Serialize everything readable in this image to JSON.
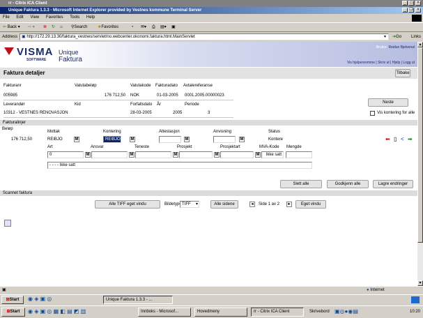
{
  "citrix": {
    "title": "rr - Citrix ICA Client"
  },
  "ie": {
    "title": "Unique Faktura 1.3.3 - Microsoft Internet Explorer provided by Vestnes kommune  Terminal Server",
    "menu": [
      "File",
      "Edit",
      "View",
      "Favorites",
      "Tools",
      "Help"
    ],
    "toolbar": {
      "back": "Back",
      "search": "Search",
      "favorites": "Favorites"
    },
    "address_label": "Address",
    "address_value": "http://172.29.13.30/faktura_vestnes/servlet/no.webcenter.okonomi.faktura.html.MainServlet",
    "go_label": "Go",
    "links_label": "Links",
    "status_zone": "Internet"
  },
  "app": {
    "brand_main": "VISMA",
    "brand_sub": "SOFTWARE",
    "product_line1": "Unique",
    "product_line2": "Faktura",
    "user_prefix": "Bruker:",
    "user_name": "Reidun Bjelvenal",
    "nav": [
      "Vis hjelpereomme",
      "Skriv ut",
      "Hjelp",
      "Logg ut"
    ],
    "page_title": "Faktura detaljer",
    "back_button": "Tilbake"
  },
  "header": {
    "fakturanr_label": "Fakturanr",
    "fakturanr": "005985",
    "valutabelop_label": "Valutabeløp",
    "valutabelop": "176 712,50",
    "valutakode_label": "Valutakode",
    "valutakode": "NOK",
    "fakturadato_label": "Fakturadato",
    "fakturadato": "01-03-2005",
    "avtalereferanse_label": "Avtalereferanse",
    "avtalereferanse": "0001.2005.00000023",
    "leverandor_label": "Leverandør",
    "leverandor": "10312 - VESTNES RENOVASJON",
    "kid_label": "Kid",
    "forfallsdato_label": "Forfallsdato",
    "forfallsdato": "28-03-2005",
    "ar_label": "År",
    "ar": "2005",
    "periode_label": "Periode",
    "periode": "3",
    "neste_button": "Neste",
    "vis_kontering_label": "Vis kontering for alle"
  },
  "fakturalinjer": {
    "section_title": "Fakturalinjer",
    "belop_label": "Beløp",
    "belop": "176 712,50",
    "mottak_label": "Mottak",
    "mottak": "REIBJO",
    "kontering_label": "Kontering",
    "kontering": "REIBJO",
    "attestasjon_label": "Attestasjon",
    "anvisning_label": "Anvisning",
    "status_label": "Status",
    "status": "Kontere",
    "art_label": "Art",
    "art": "0",
    "ansvar_label": "Ansvar",
    "tjeneste_label": "Teneste",
    "prosjekt_label": "Prosjekt",
    "prosjektart_label": "Prosjektart",
    "mva_label": "MVA-Kode",
    "mva": "Ikke satt",
    "mengde_label": "Mengde",
    "description": "- - - - Ikke satt",
    "buttons": [
      "Slett alle",
      "Godkjenn alle",
      "Lagre endringer"
    ]
  },
  "scannet": {
    "section_title": "Scannet faktura",
    "alle_tiff_button": "Alle TIFF eget vindu",
    "bildetype_label": "Bildetype:",
    "bildetype_value": "TIFF",
    "alle_sidene_button": "Alle sidene",
    "page_info": "Side 1 av 2",
    "eget_vindu_button": "Eget vindu"
  },
  "citrix_taskbar": {
    "start": "Start",
    "task": "Unique Faktura 1.3.3 - ..."
  },
  "windows_taskbar": {
    "start": "Start",
    "tasks": [
      "Innboks - Microsof...",
      "Hovedmeny",
      "rr - Citrix ICA Client"
    ],
    "desktop_label": "Skrivebord",
    "clock": "10:20"
  }
}
